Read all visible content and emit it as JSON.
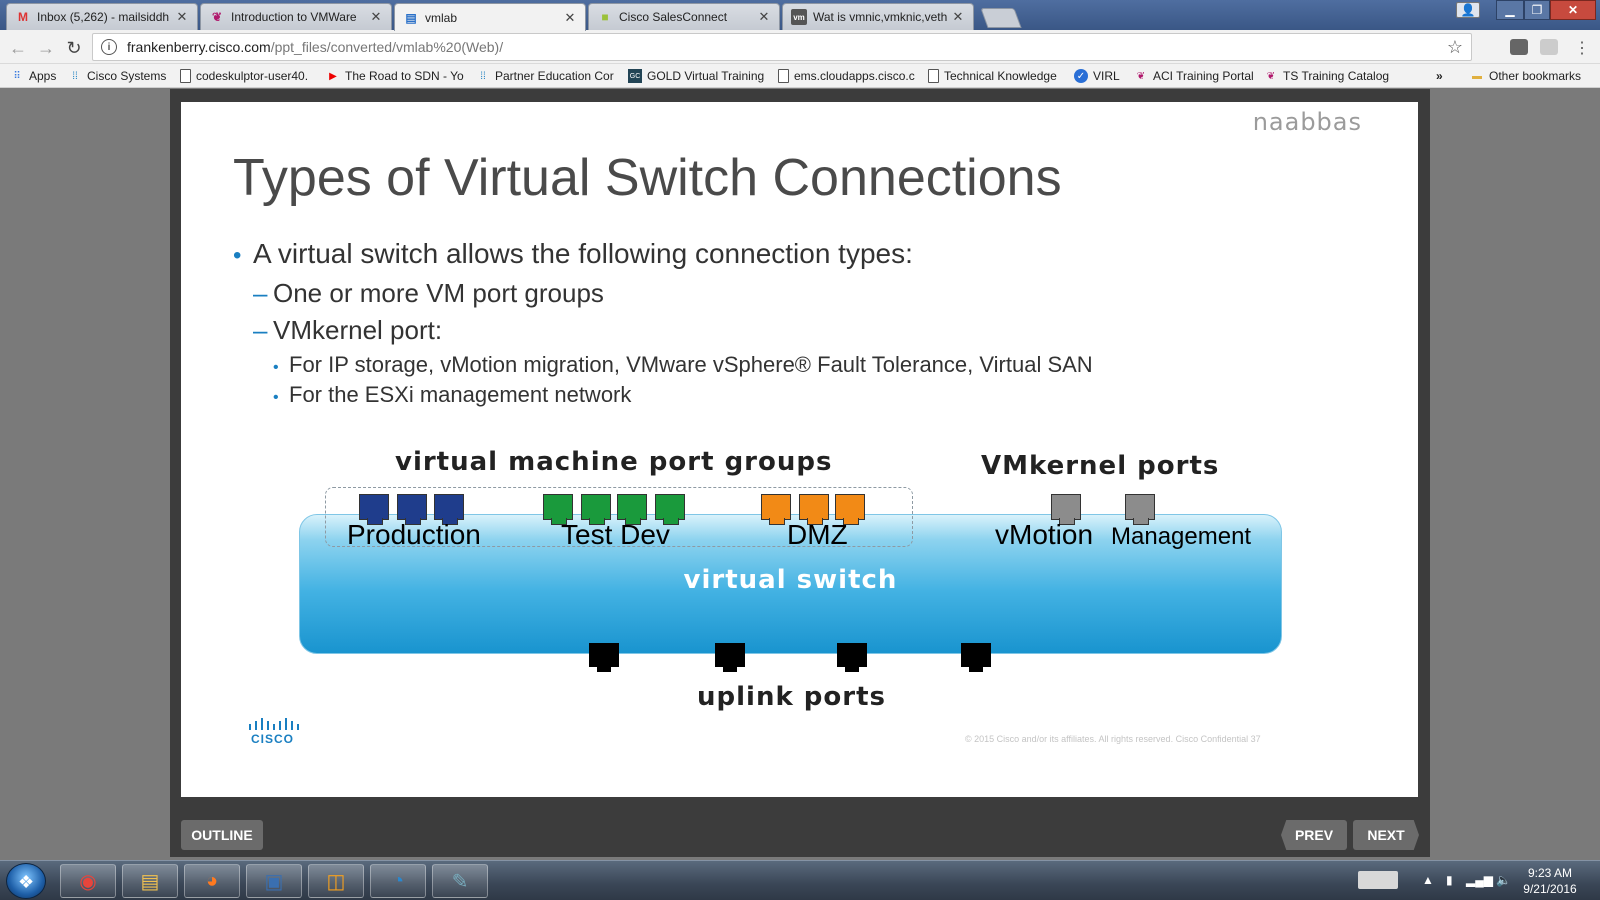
{
  "browser": {
    "tabs": [
      {
        "label": "Inbox (5,262) - mailsiddh",
        "icon": "gmail-icon",
        "active": false
      },
      {
        "label": "Introduction to VMWare",
        "icon": "feather-icon",
        "active": false
      },
      {
        "label": "vmlab",
        "icon": "page-icon",
        "active": true
      },
      {
        "label": "Cisco SalesConnect",
        "icon": "folder-icon",
        "active": false
      },
      {
        "label": "Wat is vmnic,vmknic,veth",
        "icon": "vm-icon",
        "active": false
      }
    ],
    "url_host": "frankenberry.cisco.com",
    "url_path": "/ppt_files/converted/vmlab%20(Web)/",
    "bookmarks": [
      {
        "label": "Apps",
        "icon": "apps-grid-icon"
      },
      {
        "label": "Cisco Systems",
        "icon": "cisco-icon"
      },
      {
        "label": "codeskulptor-user40.",
        "icon": "doc-icon"
      },
      {
        "label": "The Road to SDN - Yo",
        "icon": "youtube-icon"
      },
      {
        "label": "Partner Education Cor",
        "icon": "cisco-icon"
      },
      {
        "label": "GOLD Virtual Training",
        "icon": "gold-icon"
      },
      {
        "label": "ems.cloudapps.cisco.c",
        "icon": "doc-icon"
      },
      {
        "label": "Technical Knowledge",
        "icon": "doc-icon"
      },
      {
        "label": "VIRL",
        "icon": "virl-icon"
      },
      {
        "label": "ACI Training Portal",
        "icon": "feather-icon"
      },
      {
        "label": "TS Training Catalog",
        "icon": "feather-icon"
      }
    ],
    "overflow_label": "»",
    "other_bookmarks": "Other bookmarks"
  },
  "slide": {
    "watermark": "naabbas",
    "title": "Types of Virtual Switch Connections",
    "bullet1": "A virtual switch allows the following connection types:",
    "sub1": "One or more VM port groups",
    "sub2": "VMkernel port:",
    "subsub1": "For IP storage, vMotion migration, VMware vSphere® Fault Tolerance, Virtual SAN",
    "subsub2": "For the ESXi management network",
    "bullet_mark": "•",
    "dash_mark": "–",
    "diagram": {
      "vm_header": "virtual machine port groups",
      "vmk_header": "VMkernel ports",
      "switch_label": "virtual switch",
      "uplink_label": "uplink ports",
      "groups": [
        {
          "label": "Production",
          "ports": 3,
          "color": "#1f3d8c"
        },
        {
          "label": "Test Dev",
          "ports": 4,
          "color": "#1a9a3c"
        },
        {
          "label": "DMZ",
          "ports": 3,
          "color": "#f28a16"
        }
      ],
      "vmkernel": [
        {
          "label": "vMotion",
          "color": "#8c8c8c"
        },
        {
          "label": "Management",
          "color": "#8c8c8c"
        }
      ],
      "uplinks": 4
    },
    "logo_text": "CISCO",
    "footer": "© 2015 Cisco and/or its affiliates. All rights reserved.   Cisco Confidential         37"
  },
  "controls": {
    "outline": "OUTLINE",
    "prev": "PREV",
    "next": "NEXT"
  },
  "taskbar": {
    "time": "9:23 AM",
    "date": "9/21/2016",
    "apps": [
      "chrome-icon",
      "explorer-icon",
      "firefox-icon",
      "python-icon",
      "outlook-icon",
      "webex-icon",
      "paint-icon"
    ]
  }
}
